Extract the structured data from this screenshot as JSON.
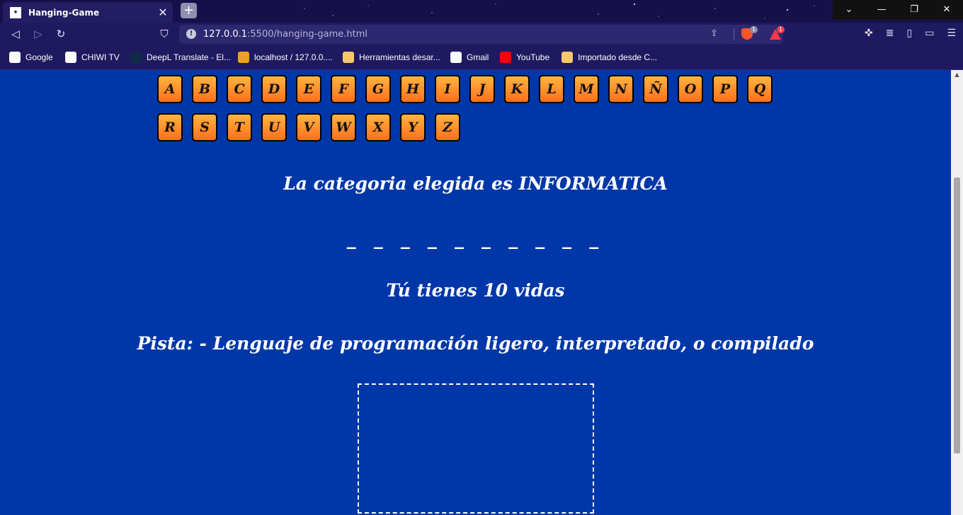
{
  "browser": {
    "tab_title": "Hanging-Game",
    "url_host": "127.0.0.1",
    "url_path": ":5500/hanging-game.html",
    "brave_badge": "1",
    "alert_badge": "1",
    "bookmarks": [
      {
        "label": "Google",
        "icon": "google-icon",
        "color": "#ffffff"
      },
      {
        "label": "CHIWI TV",
        "icon": "tv-icon",
        "color": "#ffffff"
      },
      {
        "label": "DeepL Translate - El...",
        "icon": "deepl-icon",
        "color": "#0f2b46"
      },
      {
        "label": "localhost / 127.0.0....",
        "icon": "phpmyadmin-icon",
        "color": "#f0a020"
      },
      {
        "label": "Herramientas desar...",
        "icon": "folder-icon",
        "color": "#f5c86a"
      },
      {
        "label": "Gmail",
        "icon": "gmail-icon",
        "color": "#ffffff"
      },
      {
        "label": "YouTube",
        "icon": "youtube-icon",
        "color": "#ff0000"
      },
      {
        "label": "Importado desde C...",
        "icon": "folder-icon",
        "color": "#f5c86a"
      }
    ]
  },
  "game": {
    "letters_row1": [
      "A",
      "B",
      "C",
      "D",
      "E",
      "F",
      "G",
      "H",
      "I",
      "J",
      "K",
      "L",
      "M",
      "N",
      "Ñ",
      "O",
      "P",
      "Q"
    ],
    "letters_row2": [
      "R",
      "S",
      "T",
      "U",
      "V",
      "W",
      "X",
      "Y",
      "Z"
    ],
    "category_text": "La categoria elegida es INFORMATICA",
    "blanks": "_ _ _ _ _ _ _ _ _ _",
    "lives_text": "Tú tienes 10 vidas",
    "hint_text": "Pista: - Lenguaje de programación ligero, interpretado, o compilado"
  },
  "colors": {
    "page_bg": "#0037a8",
    "key_top": "#ffb43f",
    "key_bottom": "#ff6f1e"
  }
}
